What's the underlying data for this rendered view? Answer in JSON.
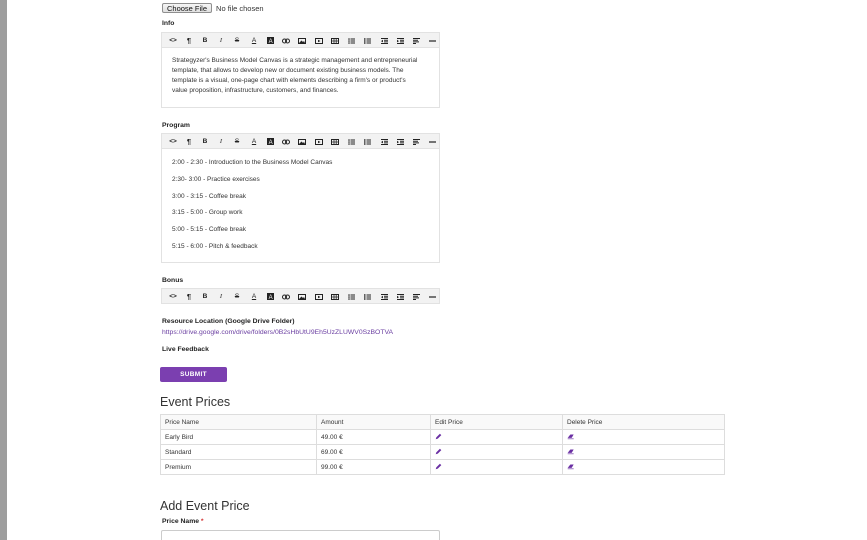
{
  "file_input": {
    "button_label": "Choose File",
    "status": "No file chosen"
  },
  "toolbar_icons": [
    "code-view-icon",
    "paragraph-icon",
    "bold-icon",
    "italic-icon",
    "strikethrough-icon",
    "font-color-icon",
    "background-color-icon",
    "link-icon",
    "image-icon",
    "video-icon",
    "table-icon",
    "unordered-list-icon",
    "ordered-list-icon",
    "outdent-icon",
    "indent-icon",
    "align-icon",
    "horizontal-rule-icon"
  ],
  "info": {
    "label": "Info",
    "lines": [
      "Strategyzer's Business Model Canvas is a strategic management and entrepreneurial",
      "template, that allows to develop new or document existing business models. The",
      "template is a visual, one-page chart with elements describing a firm's or product's",
      "value proposition, infrastructure, customers, and finances."
    ]
  },
  "program": {
    "label": "Program",
    "lines": [
      "2:00 - 2:30 - Introduction to the Business Model Canvas",
      "2:30- 3:00 - Practice exercises",
      "3:00 - 3:15 - Coffee break",
      "3:15 - 5:00 - Group work",
      "5:00 - 5:15 - Coffee break",
      "5:15 - 6:00 - Pitch & feedback"
    ]
  },
  "bonus": {
    "label": "Bonus"
  },
  "resource": {
    "label": "Resource Location (Google Drive Folder)",
    "link": "https://drive.google.com/drive/folders/0B2sHbUtU9Eh5UzZLUWV0SzBOTVA"
  },
  "live_feedback": {
    "label": "Live Feedback"
  },
  "submit_label": "SUBMIT",
  "event_prices": {
    "title": "Event Prices",
    "columns": [
      "Price Name",
      "Amount",
      "Edit Price",
      "Delete Price"
    ],
    "rows": [
      {
        "name": "Early Bird",
        "amount": "49.00 €"
      },
      {
        "name": "Standard",
        "amount": "69.00 €"
      },
      {
        "name": "Premium",
        "amount": "99.00 €"
      }
    ]
  },
  "add_event_price": {
    "title": "Add Event Price",
    "price_name_label": "Price Name",
    "required_mark": "*"
  },
  "colors": {
    "accent": "#7b3fb0",
    "link": "#6a3ea1",
    "required": "#d32f2f"
  }
}
